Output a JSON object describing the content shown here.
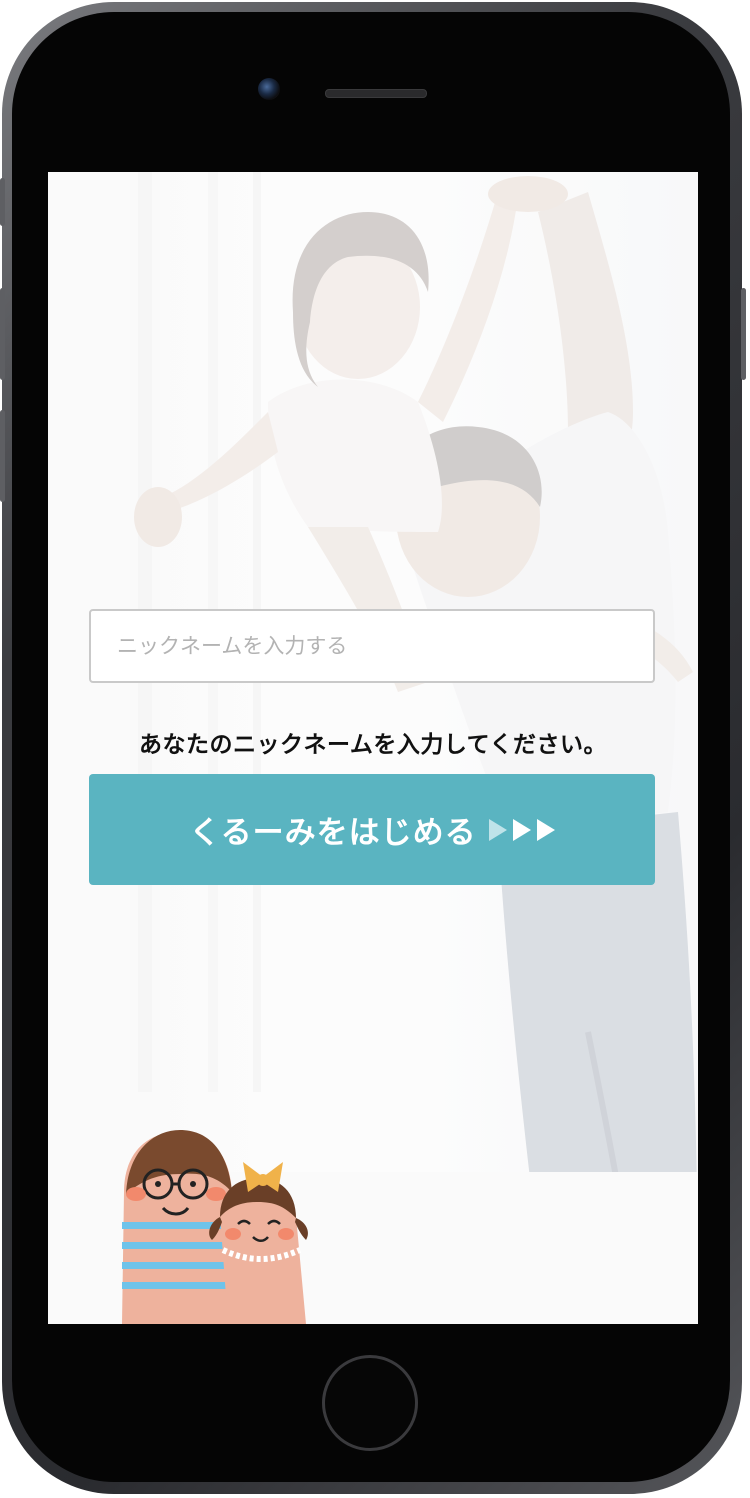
{
  "login": {
    "nickname_placeholder": "ニックネームを入力する",
    "nickname_value": "",
    "instruction": "あなたのニックネームを入力してください。",
    "start_button_label": "くるーみをはじめる"
  },
  "colors": {
    "accent": "#5ab4c1",
    "input_border": "#c9c9c9",
    "text": "#111111"
  },
  "icons": {
    "button_arrows": "triple-play-arrow-icon",
    "mascot": "finger-family-illustration"
  }
}
